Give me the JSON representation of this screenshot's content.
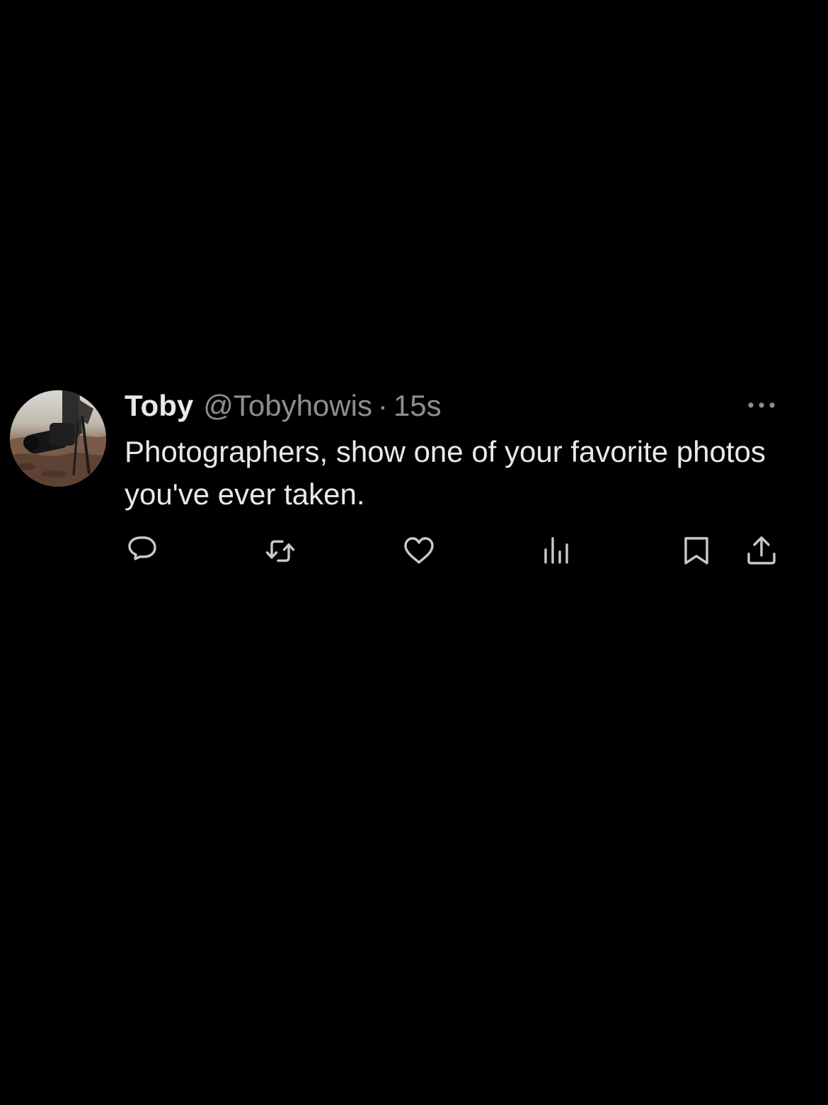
{
  "tweet": {
    "display_name": "Toby",
    "handle": "@Tobyhowis",
    "separator": "·",
    "timestamp": "15s",
    "text": "Photographers, show one of your favorite photos you've ever taken."
  },
  "icons": {
    "avatar": "profile-photo",
    "more": "more-horizontal-icon",
    "reply": "reply-icon",
    "retweet": "retweet-icon",
    "like": "heart-icon",
    "views": "views-icon",
    "bookmark": "bookmark-icon",
    "share": "share-icon"
  },
  "colors": {
    "background": "#000000",
    "primary_text": "#e7e9ea",
    "secondary_text": "#8b8f93",
    "icon": "#c7cbcf"
  }
}
